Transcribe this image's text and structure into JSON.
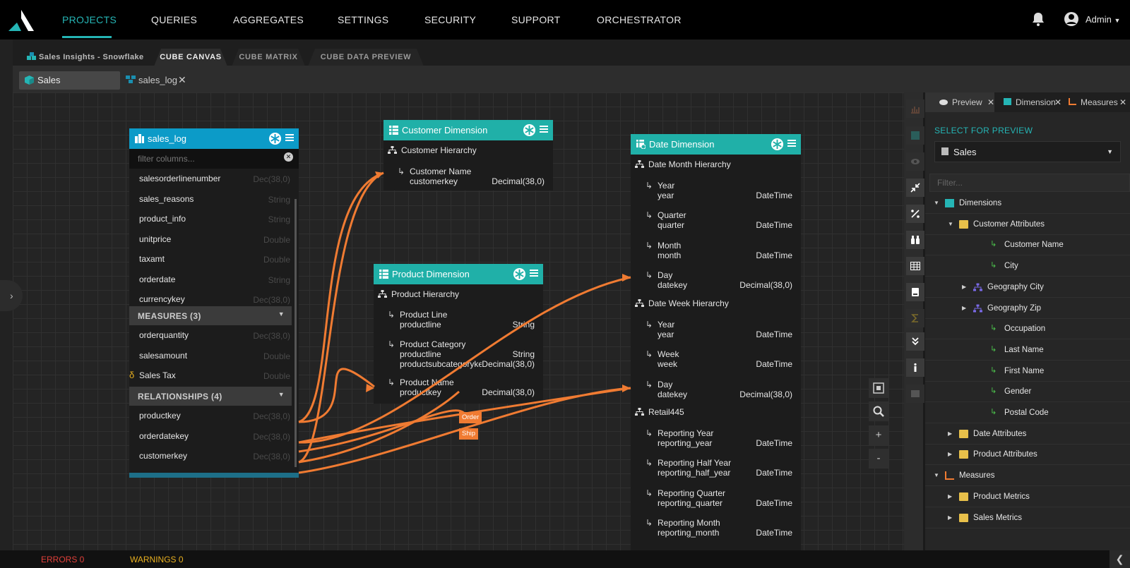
{
  "nav": {
    "items": [
      "PROJECTS",
      "QUERIES",
      "AGGREGATES",
      "SETTINGS",
      "SECURITY",
      "SUPPORT",
      "ORCHESTRATOR"
    ],
    "active": "PROJECTS",
    "user": "Admin"
  },
  "project": {
    "title": "Sales Insights - Snowflake",
    "tabs": [
      "CUBE CANVAS",
      "CUBE MATRIX",
      "CUBE DATA PREVIEW"
    ],
    "active_tab": "CUBE CANVAS"
  },
  "subtabs": [
    "Sales",
    "sales_log"
  ],
  "sales_log": {
    "title": "sales_log",
    "filter_placeholder": "filter columns...",
    "columns": [
      {
        "name": "salesorderlinenumber",
        "type": "Dec(38,0)"
      },
      {
        "name": "sales_reasons",
        "type": "String"
      },
      {
        "name": "product_info",
        "type": "String"
      },
      {
        "name": "unitprice",
        "type": "Double"
      },
      {
        "name": "taxamt",
        "type": "Double"
      },
      {
        "name": "orderdate",
        "type": "String"
      },
      {
        "name": "currencykey",
        "type": "Dec(38,0)"
      }
    ],
    "measures_header": "MEASURES (3)",
    "measures": [
      {
        "name": "orderquantity",
        "type": "Dec(38,0)"
      },
      {
        "name": "salesamount",
        "type": "Double"
      },
      {
        "name": "Sales Tax",
        "type": "Double",
        "prefix": "δ"
      }
    ],
    "relationships_header": "RELATIONSHIPS (4)",
    "relationships": [
      {
        "name": "productkey",
        "type": "Dec(38,0)"
      },
      {
        "name": "orderdatekey",
        "type": "Dec(38,0)"
      },
      {
        "name": "customerkey",
        "type": "Dec(38,0)"
      }
    ]
  },
  "customer_dim": {
    "title": "Customer Dimension",
    "hierarchy": "Customer Hierarchy",
    "levels": [
      {
        "name": "Customer Name",
        "key": "customerkey",
        "type": "Decimal(38,0)"
      }
    ]
  },
  "product_dim": {
    "title": "Product Dimension",
    "hierarchy": "Product Hierarchy",
    "levels": [
      {
        "name": "Product Line",
        "key": "productline",
        "type": "String"
      },
      {
        "name": "Product Category",
        "key": "productline",
        "key2": "productsubcategorykey",
        "type": "String",
        "type2": "Decimal(38,0)"
      },
      {
        "name": "Product Name",
        "key": "productkey",
        "type": "Decimal(38,0)"
      }
    ]
  },
  "date_dim": {
    "title": "Date Dimension",
    "h1": "Date Month Hierarchy",
    "h1_levels": [
      {
        "name": "Year",
        "key": "year",
        "type": "DateTime"
      },
      {
        "name": "Quarter",
        "key": "quarter",
        "type": "DateTime"
      },
      {
        "name": "Month",
        "key": "month",
        "type": "DateTime"
      },
      {
        "name": "Day",
        "key": "datekey",
        "type": "Decimal(38,0)"
      }
    ],
    "h2": "Date Week Hierarchy",
    "h2_levels": [
      {
        "name": "Year",
        "key": "year",
        "type": "DateTime"
      },
      {
        "name": "Week",
        "key": "week",
        "type": "DateTime"
      },
      {
        "name": "Day",
        "key": "datekey",
        "type": "Decimal(38,0)"
      }
    ],
    "h3": "Retail445",
    "h3_levels": [
      {
        "name": "Reporting Year",
        "key": "reporting_year",
        "type": "DateTime"
      },
      {
        "name": "Reporting Half Year",
        "key": "reporting_half_year",
        "type": "DateTime"
      },
      {
        "name": "Reporting Quarter",
        "key": "reporting_quarter",
        "type": "DateTime"
      },
      {
        "name": "Reporting Month",
        "key": "reporting_month",
        "type": "DateTime"
      }
    ]
  },
  "link_tags": [
    "Order",
    "Ship"
  ],
  "zoom": {
    "plus": "+",
    "minus": "-"
  },
  "panel": {
    "tabs": [
      "Preview",
      "Dimension",
      "Measures"
    ],
    "select_label": "SELECT FOR PREVIEW",
    "select_value": "Sales",
    "filter_placeholder": "Filter...",
    "tree": [
      {
        "label": "Dimensions",
        "level": 0,
        "icon": "dimensions-icon",
        "expanded": true
      },
      {
        "label": "Customer Attributes",
        "level": 1,
        "icon": "folder-icon",
        "expanded": true
      },
      {
        "label": "Customer Name",
        "level": 2,
        "icon": "attribute-icon"
      },
      {
        "label": "City",
        "level": 2,
        "icon": "attribute-icon"
      },
      {
        "label": "Geography City",
        "level": 2,
        "icon": "hierarchy-icon",
        "expanded": false
      },
      {
        "label": "Geography Zip",
        "level": 2,
        "icon": "hierarchy-icon",
        "expanded": false
      },
      {
        "label": "Occupation",
        "level": 2,
        "icon": "attribute-icon"
      },
      {
        "label": "Last Name",
        "level": 2,
        "icon": "attribute-icon"
      },
      {
        "label": "First Name",
        "level": 2,
        "icon": "attribute-icon"
      },
      {
        "label": "Gender",
        "level": 2,
        "icon": "attribute-icon"
      },
      {
        "label": "Postal Code",
        "level": 2,
        "icon": "attribute-icon"
      },
      {
        "label": "Date Attributes",
        "level": 1,
        "icon": "folder-icon",
        "expanded": false
      },
      {
        "label": "Product Attributes",
        "level": 1,
        "icon": "folder-icon",
        "expanded": false
      },
      {
        "label": "Measures",
        "level": 0,
        "icon": "measures-icon",
        "expanded": true
      },
      {
        "label": "Product Metrics",
        "level": 1,
        "icon": "folder-icon",
        "expanded": false
      },
      {
        "label": "Sales Metrics",
        "level": 1,
        "icon": "folder-icon",
        "expanded": false
      }
    ]
  },
  "status": {
    "errors": "ERRORS 0",
    "warnings": "WARNINGS 0"
  },
  "colors": {
    "accent": "#25b5b5",
    "link": "#f07b32",
    "sales_log_header": "#0c9bc8",
    "error": "#e0403a",
    "warning": "#e8b020"
  }
}
